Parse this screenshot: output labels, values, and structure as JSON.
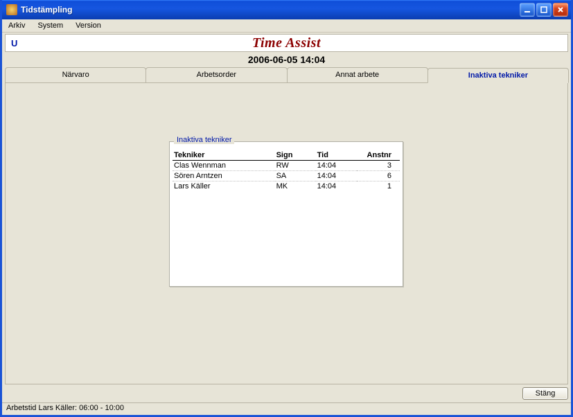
{
  "window": {
    "title": "Tidstämpling"
  },
  "menu": {
    "items": [
      "Arkiv",
      "System",
      "Version"
    ]
  },
  "header": {
    "u": "U",
    "brand": "Time Assist",
    "datetime": "2006-06-05 14:04"
  },
  "tabs": {
    "items": [
      {
        "label": "Närvaro"
      },
      {
        "label": "Arbetsorder"
      },
      {
        "label": "Annat arbete"
      },
      {
        "label": "Inaktiva tekniker"
      }
    ],
    "active_index": 3
  },
  "panel": {
    "caption": "Inaktiva tekniker",
    "columns": {
      "tekniker": "Tekniker",
      "sign": "Sign",
      "tid": "Tid",
      "anstnr": "Anstnr"
    },
    "rows": [
      {
        "tekniker": "Clas Wennman",
        "sign": "RW",
        "tid": "14:04",
        "anstnr": "3"
      },
      {
        "tekniker": "Sören Arntzen",
        "sign": "SA",
        "tid": "14:04",
        "anstnr": "6"
      },
      {
        "tekniker": "Lars Käller",
        "sign": "MK",
        "tid": "14:04",
        "anstnr": "1"
      }
    ]
  },
  "footer": {
    "close_label": "Stäng"
  },
  "status": {
    "text": "Arbetstid Lars Käller: 06:00 - 10:00"
  }
}
